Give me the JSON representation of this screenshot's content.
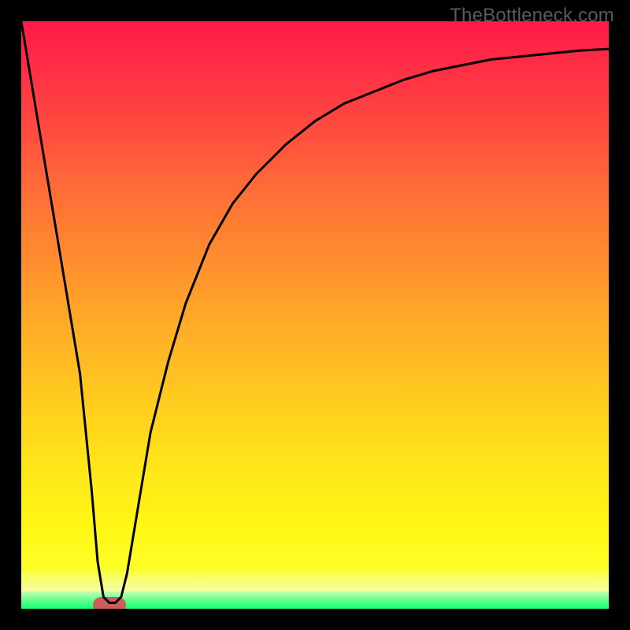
{
  "watermark": "TheBottleneck.com",
  "colors": {
    "frame": "#000000",
    "curve": "#000000",
    "blob": "#cd5c5c",
    "gradient_top": "#ff1a49",
    "gradient_mid": "#ffc91f",
    "gradient_low": "#fdff2a",
    "band_lightyellow": "#f3ffa8",
    "band_green": "#18ff78"
  },
  "chart_data": {
    "type": "line",
    "title": "",
    "xlabel": "",
    "ylabel": "",
    "xlim": [
      0,
      100
    ],
    "ylim": [
      0,
      100
    ],
    "grid": false,
    "legend": false,
    "series": [
      {
        "name": "curve",
        "x": [
          0,
          2,
          4,
          6,
          8,
          10,
          12,
          13,
          14,
          15,
          16,
          17,
          18,
          20,
          22,
          25,
          28,
          32,
          36,
          40,
          45,
          50,
          55,
          60,
          65,
          70,
          75,
          80,
          85,
          90,
          95,
          100
        ],
        "y": [
          100,
          88,
          76,
          64,
          52,
          40,
          20,
          8,
          2,
          1,
          1,
          2,
          6,
          18,
          30,
          42,
          52,
          62,
          69,
          74,
          79,
          83,
          86,
          88,
          90,
          91.5,
          92.5,
          93.5,
          94,
          94.5,
          95,
          95.3
        ]
      }
    ],
    "annotations": [
      {
        "name": "trough-marker",
        "x": 15,
        "y": 1,
        "shape": "rounded-blob",
        "color": "#cd5c5c"
      }
    ],
    "background": {
      "type": "vertical-gradient",
      "stops": [
        {
          "pos": 0.0,
          "color": "#ff1a49"
        },
        {
          "pos": 0.45,
          "color": "#ff8a2f"
        },
        {
          "pos": 0.8,
          "color": "#ffe419"
        },
        {
          "pos": 0.94,
          "color": "#f3ffa8"
        },
        {
          "pos": 1.0,
          "color": "#18ff78"
        }
      ]
    }
  }
}
